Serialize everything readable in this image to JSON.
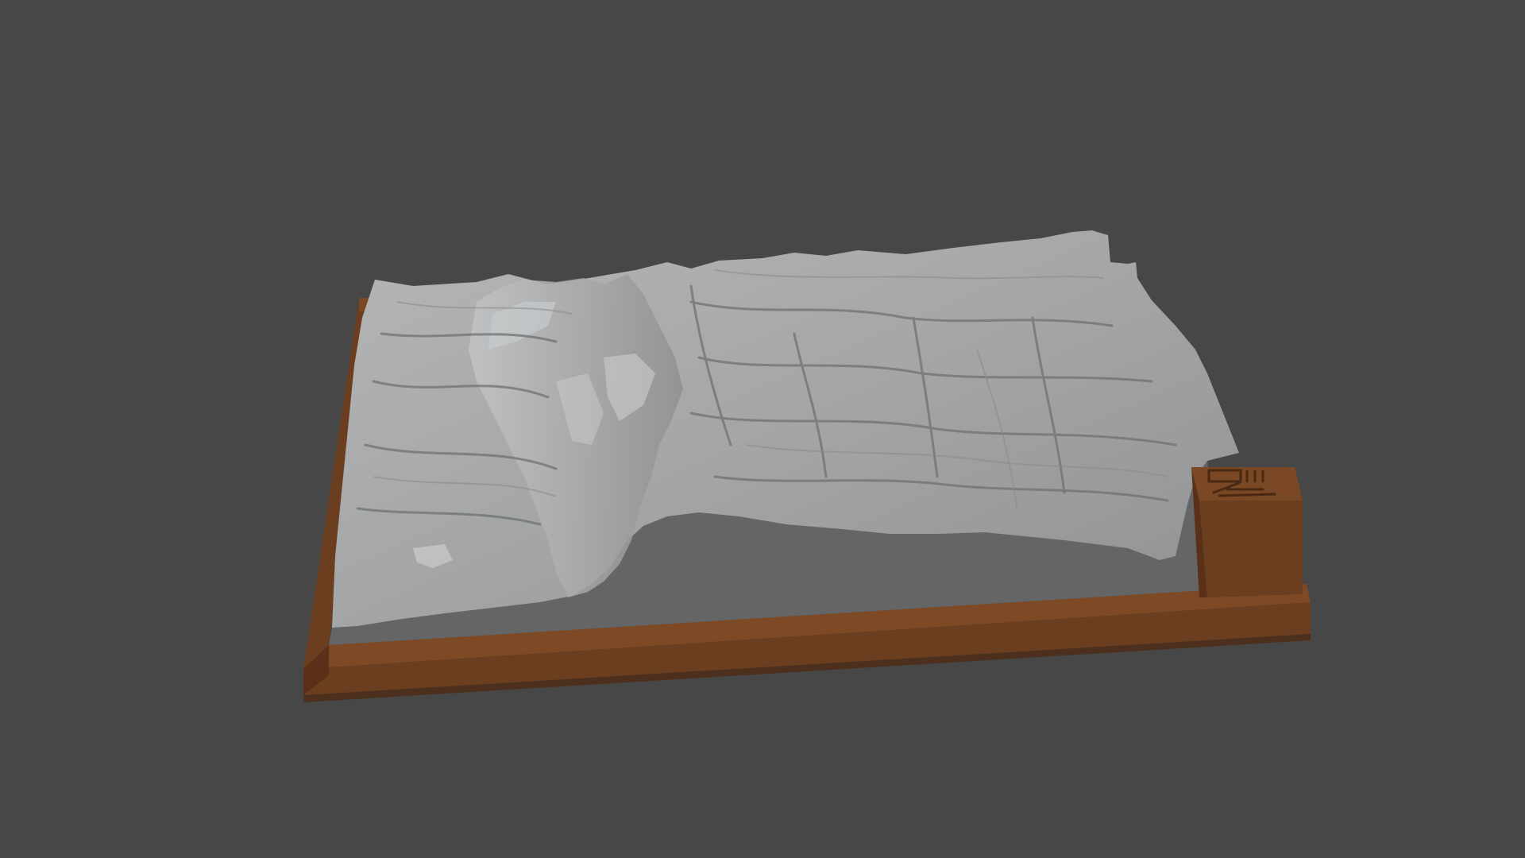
{
  "viewport": {
    "background_color": "#474747"
  },
  "model": {
    "terrain_color": "#a4a6a8",
    "terrain_shadow_color": "#6c6e70",
    "terrain_highlight_color": "#c9cbcd",
    "flat_base_color": "#646566",
    "frame_color": "#6b3e1f",
    "frame_dark_color": "#552f16",
    "frame_light_color": "#7a4824"
  },
  "label_block": {
    "engraving": "icon-markings"
  }
}
